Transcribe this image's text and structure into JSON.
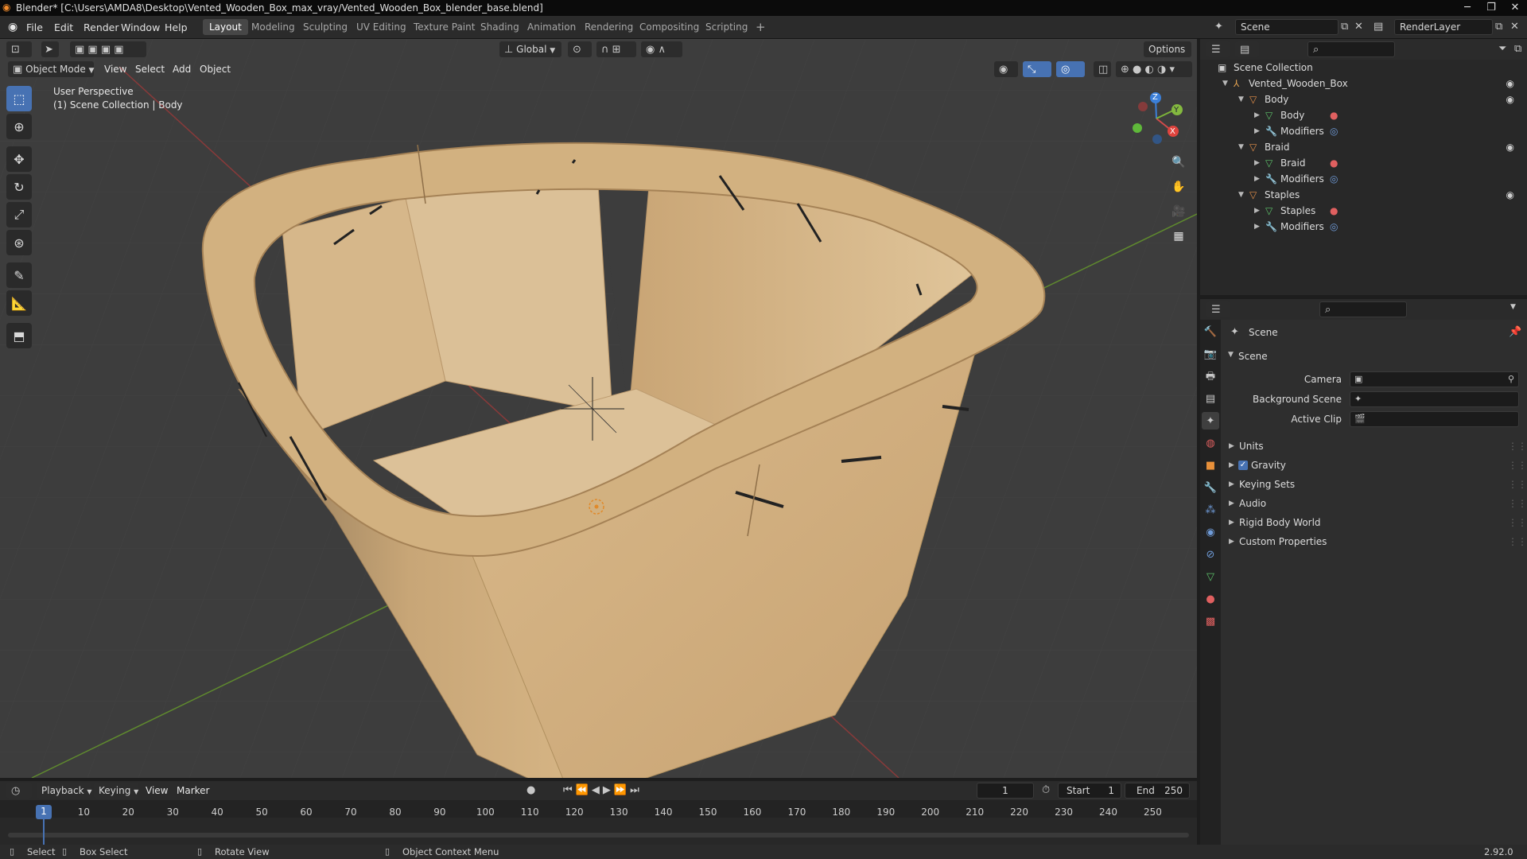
{
  "window": {
    "title": "Blender* [C:\\Users\\AMDA8\\Desktop\\Vented_Wooden_Box_max_vray/Vented_Wooden_Box_blender_base.blend]",
    "minimize": "─",
    "maximize": "❐",
    "close": "✕"
  },
  "menu": [
    "File",
    "Edit",
    "Render",
    "Window",
    "Help"
  ],
  "workspaces": [
    "Layout",
    "Modeling",
    "Sculpting",
    "UV Editing",
    "Texture Paint",
    "Shading",
    "Animation",
    "Rendering",
    "Compositing",
    "Scripting"
  ],
  "workspace_add": "+",
  "scene_field": "Scene",
  "renderlayer_field": "RenderLayer",
  "viewport": {
    "transform_orientation": "Global",
    "options": "Options",
    "mode": "Object Mode",
    "header_menus": [
      "View",
      "Select",
      "Add",
      "Object"
    ],
    "perspective_label": "User Perspective",
    "collection_label": "(1) Scene Collection | Body",
    "gizmo": {
      "x": "X",
      "y": "Y",
      "z": "Z"
    }
  },
  "outliner": {
    "root": "Scene Collection",
    "items": [
      {
        "label": "Vented_Wooden_Box",
        "indent": 0,
        "icon": "⅄",
        "color": "#e0a050",
        "eye": true
      },
      {
        "label": "Body",
        "indent": 1,
        "icon": "▽",
        "color": "#e5904a",
        "eye": true
      },
      {
        "label": "Body",
        "indent": 2,
        "icon": "▽",
        "color": "#5dc16a",
        "eye": false,
        "tag": "material"
      },
      {
        "label": "Modifiers",
        "indent": 2,
        "icon": "🔧",
        "color": "#6f9bd8",
        "eye": false,
        "tag": "modifier"
      },
      {
        "label": "Braid",
        "indent": 1,
        "icon": "▽",
        "color": "#e5904a",
        "eye": true
      },
      {
        "label": "Braid",
        "indent": 2,
        "icon": "▽",
        "color": "#5dc16a",
        "eye": false,
        "tag": "material"
      },
      {
        "label": "Modifiers",
        "indent": 2,
        "icon": "🔧",
        "color": "#6f9bd8",
        "eye": false,
        "tag": "modifier"
      },
      {
        "label": "Staples",
        "indent": 1,
        "icon": "▽",
        "color": "#e5904a",
        "eye": true
      },
      {
        "label": "Staples",
        "indent": 2,
        "icon": "▽",
        "color": "#5dc16a",
        "eye": false,
        "tag": "material"
      },
      {
        "label": "Modifiers",
        "indent": 2,
        "icon": "🔧",
        "color": "#6f9bd8",
        "eye": false,
        "tag": "modifier"
      }
    ]
  },
  "properties": {
    "context": "Scene",
    "panel": "Scene",
    "camera_label": "Camera",
    "background_scene_label": "Background Scene",
    "active_clip_label": "Active Clip",
    "sections": [
      "Units",
      "Gravity",
      "Keying Sets",
      "Audio",
      "Rigid Body World",
      "Custom Properties"
    ],
    "gravity_checked": true
  },
  "timeline": {
    "menus": [
      "Playback",
      "Keying",
      "View",
      "Marker"
    ],
    "current_frame": "1",
    "start_label": "Start",
    "start": "1",
    "end_label": "End",
    "end": "250",
    "ticks": [
      "1",
      "10",
      "20",
      "30",
      "40",
      "50",
      "60",
      "70",
      "80",
      "90",
      "100",
      "110",
      "120",
      "130",
      "140",
      "150",
      "160",
      "170",
      "180",
      "190",
      "200",
      "210",
      "220",
      "230",
      "240",
      "250"
    ]
  },
  "status": {
    "select": "Select",
    "box_select": "Box Select",
    "rotate_view": "Rotate View",
    "context_menu": "Object Context Menu",
    "version": "2.92.0"
  }
}
